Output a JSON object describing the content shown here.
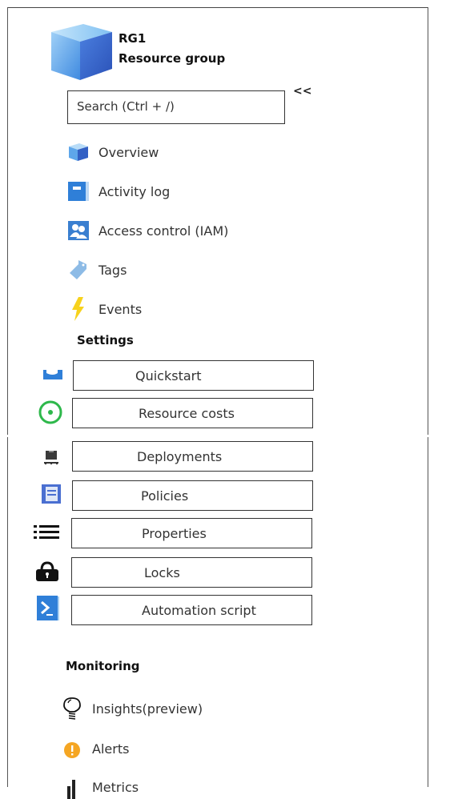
{
  "header": {
    "name": "RG1",
    "subtitle": "Resource group",
    "icon": "resource-group-cube-icon"
  },
  "search": {
    "placeholder": "Search (Ctrl + /)",
    "value": "",
    "collapse_label": "<<"
  },
  "nav": {
    "items": [
      {
        "label": "Overview",
        "icon": "overview-cube-icon"
      },
      {
        "label": "Activity log",
        "icon": "activity-log-icon"
      },
      {
        "label": "Access control (IAM)",
        "icon": "users-icon"
      },
      {
        "label": "Tags",
        "icon": "tag-icon"
      },
      {
        "label": "Events",
        "icon": "lightning-icon"
      }
    ]
  },
  "settings": {
    "heading": "Settings",
    "items": [
      {
        "label": "Quickstart",
        "icon": "quickstart-icon"
      },
      {
        "label": "Resource costs",
        "icon": "cost-icon"
      },
      {
        "label": "Deployments",
        "icon": "deployments-icon"
      },
      {
        "label": "Policies",
        "icon": "policies-icon"
      },
      {
        "label": "Properties",
        "icon": "list-icon"
      },
      {
        "label": "Locks",
        "icon": "lock-icon"
      },
      {
        "label": "Automation script",
        "icon": "powershell-icon"
      }
    ]
  },
  "monitoring": {
    "heading": "Monitoring",
    "items": [
      {
        "label": "Insights(preview)",
        "icon": "lightbulb-icon"
      },
      {
        "label": "Alerts",
        "icon": "alert-icon"
      },
      {
        "label": "Metrics",
        "icon": "bar-chart-icon"
      }
    ]
  },
  "colors": {
    "azure_blue": "#2f7fd8",
    "cost_green": "#2eb84b",
    "alert_orange": "#f5a623",
    "event_yellow": "#f7d21c"
  }
}
